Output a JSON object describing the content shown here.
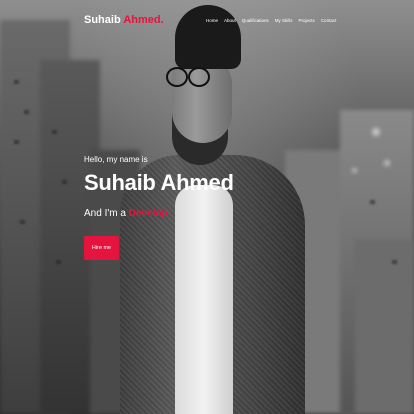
{
  "nav": {
    "logo_first": "Suhaib",
    "logo_accent": "Ahmed.",
    "links": [
      "Home",
      "About",
      "Qualifications",
      "My Skills",
      "Projects",
      "Contact"
    ]
  },
  "hero": {
    "greeting": "Hello, my name is",
    "name": "Suhaib Ahmed",
    "role_prefix": "And I'm a",
    "role_typed": "Develop",
    "cta_label": "Hire me"
  },
  "colors": {
    "accent": "#e5143f",
    "text": "#ffffff"
  }
}
